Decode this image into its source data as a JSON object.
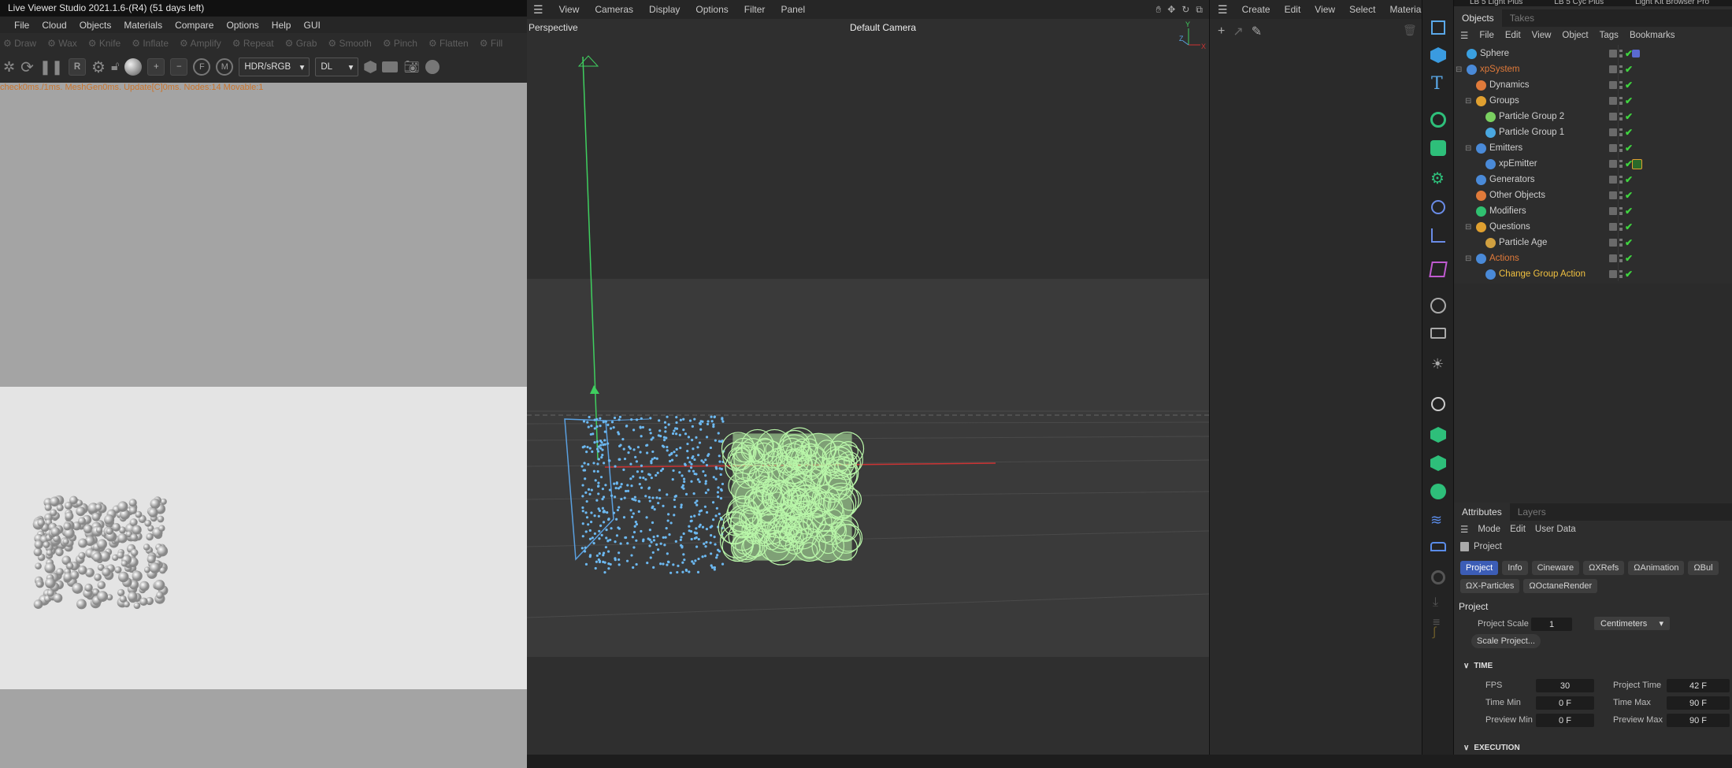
{
  "live_viewer": {
    "title": "Live Viewer Studio 2021.1.6-(R4) (51 days left)",
    "menu": [
      "File",
      "Cloud",
      "Objects",
      "Materials",
      "Compare",
      "Options",
      "Help",
      "GUI"
    ],
    "tools": [
      "Draw",
      "Wax",
      "Knife",
      "Inflate",
      "Amplify",
      "Repeat",
      "Grab",
      "Smooth",
      "Pinch",
      "Flatten",
      "Fill"
    ],
    "color_space": "HDR/sRGB",
    "render_mode": "DL",
    "status": "check0ms./1ms. MeshGen0ms. Update[C]0ms. Nodes:14 Movable:1"
  },
  "viewport": {
    "menu": [
      "View",
      "Cameras",
      "Display",
      "Options",
      "Filter",
      "Panel"
    ],
    "label": "Perspective",
    "camera": "Default Camera",
    "axes": [
      "Y",
      "Z",
      "X"
    ]
  },
  "material_panel": {
    "menu": [
      "Create",
      "Edit",
      "View",
      "Select",
      "Material"
    ]
  },
  "top_strip": [
    "LB 5 Light Plus",
    "LB 5 Cyc Plus",
    "Light Kit Browser Pro"
  ],
  "objects_panel": {
    "tabs": [
      "Objects",
      "Takes"
    ],
    "menu": [
      "File",
      "Edit",
      "View",
      "Object",
      "Tags",
      "Bookmarks"
    ],
    "items": [
      {
        "name": "Sphere",
        "color": "#cfcfcf",
        "icon_color": "#3aa0e0"
      },
      {
        "name": "xpSystem",
        "color": "#e07a3a",
        "icon_color": "#4a8ad8"
      },
      {
        "name": "Dynamics",
        "color": "#cfcfcf",
        "icon_color": "#e07a3a"
      },
      {
        "name": "Groups",
        "color": "#cfcfcf",
        "icon_color": "#e0a030"
      },
      {
        "name": "Particle Group 2",
        "color": "#cfcfcf",
        "icon_color": "#7ad060"
      },
      {
        "name": "Particle Group 1",
        "color": "#cfcfcf",
        "icon_color": "#4aa8e0"
      },
      {
        "name": "Emitters",
        "color": "#cfcfcf",
        "icon_color": "#4a8ad8"
      },
      {
        "name": "xpEmitter",
        "color": "#cfcfcf",
        "icon_color": "#4a8ad8"
      },
      {
        "name": "Generators",
        "color": "#cfcfcf",
        "icon_color": "#4a8ad8"
      },
      {
        "name": "Other Objects",
        "color": "#cfcfcf",
        "icon_color": "#e07a3a"
      },
      {
        "name": "Modifiers",
        "color": "#cfcfcf",
        "icon_color": "#30c070"
      },
      {
        "name": "Questions",
        "color": "#cfcfcf",
        "icon_color": "#e0a030"
      },
      {
        "name": "Particle Age",
        "color": "#cfcfcf",
        "icon_color": "#d0a040"
      },
      {
        "name": "Actions",
        "color": "#e07a3a",
        "icon_color": "#4a8ad8"
      },
      {
        "name": "Change Group Action",
        "color": "#f0c040",
        "icon_color": "#4a8ad8"
      }
    ]
  },
  "attributes": {
    "tabs": [
      "Attributes",
      "Layers"
    ],
    "menu": [
      "Mode",
      "Edit",
      "User Data"
    ],
    "object": "Project",
    "buttons_row1": [
      "Project",
      "Info",
      "Cineware",
      "XRefs",
      "Animation",
      "Bul"
    ],
    "buttons_row2": [
      "X-Particles",
      "OctaneRender"
    ],
    "section": "Project",
    "project_scale_label": "Project Scale",
    "project_scale_value": "1",
    "project_scale_unit": "Centimeters",
    "scale_button": "Scale Project...",
    "time_header": "TIME",
    "fps_label": "FPS",
    "fps": "30",
    "project_time_label": "Project Time",
    "project_time": "42 F",
    "time_min_label": "Time Min",
    "time_min": "0 F",
    "time_max_label": "Time Max",
    "time_max": "90 F",
    "preview_min_label": "Preview Min",
    "preview_min": "0 F",
    "preview_max_label": "Preview Max",
    "preview_max": "90 F",
    "execution_header": "EXECUTION"
  }
}
